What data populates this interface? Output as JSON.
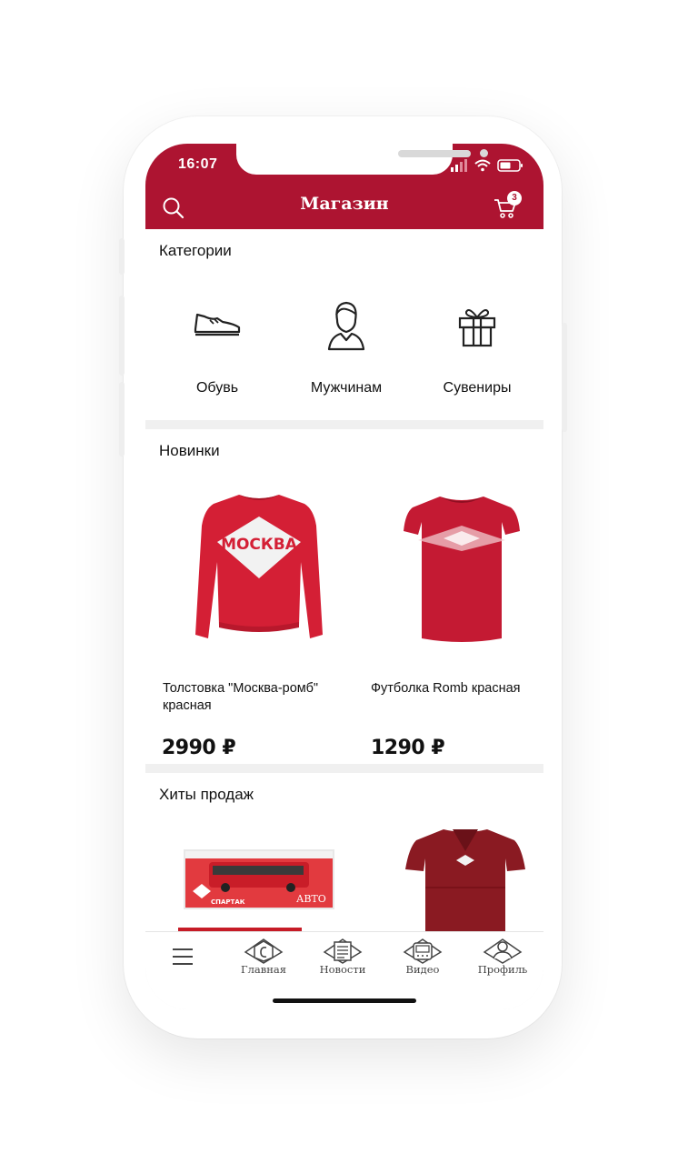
{
  "status_bar": {
    "time": "16:07"
  },
  "header": {
    "title": "Магазин",
    "cart_count": "3"
  },
  "categories": {
    "title": "Категории",
    "items": [
      {
        "label": "Обувь",
        "icon": "sneaker-icon"
      },
      {
        "label": "Мужчинам",
        "icon": "man-icon"
      },
      {
        "label": "Сувениры",
        "icon": "gift-icon"
      }
    ]
  },
  "new_items": {
    "title": "Новинки",
    "products": [
      {
        "name": "Толстовка \"Москва-ромб\" красная",
        "price": "2990 ₽"
      },
      {
        "name": "Футболка Romb красная",
        "price": "1290 ₽"
      }
    ]
  },
  "bestsellers": {
    "title": "Хиты продаж"
  },
  "tabbar": {
    "items": [
      {
        "label": "Главная",
        "icon": "home-icon"
      },
      {
        "label": "Новости",
        "icon": "news-icon"
      },
      {
        "label": "Видео",
        "icon": "video-icon"
      },
      {
        "label": "Профиль",
        "icon": "profile-icon"
      }
    ]
  },
  "colors": {
    "accent": "#ad1431",
    "background": "#f0f0f0"
  }
}
